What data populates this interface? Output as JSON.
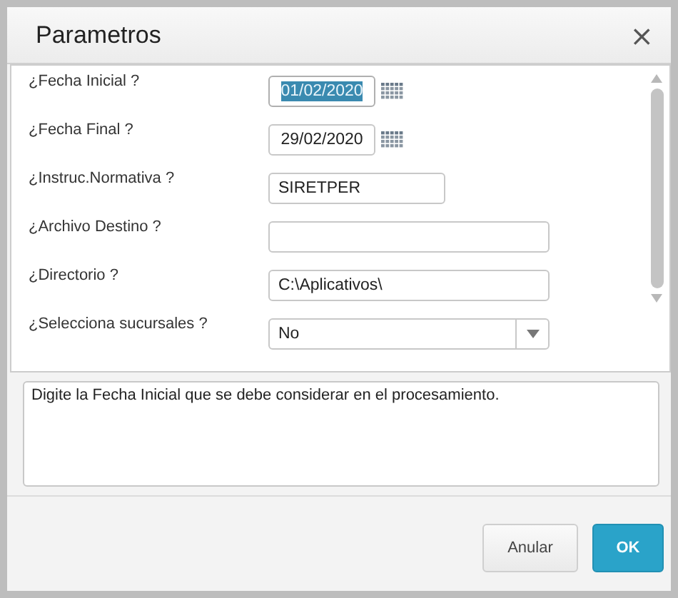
{
  "window": {
    "title": "Parametros",
    "close": "×"
  },
  "fields": [
    {
      "label": "¿Fecha Inicial ?",
      "kind": "date",
      "value": "01/02/2020",
      "selected": true
    },
    {
      "label": "¿Fecha Final ?",
      "kind": "date",
      "value": "29/02/2020",
      "selected": false
    },
    {
      "label": "¿Instruc.Normativa ?",
      "kind": "short",
      "value": "SIRETPER"
    },
    {
      "label": "¿Archivo Destino ?",
      "kind": "text"
    },
    {
      "label": "¿Directorio ?",
      "kind": "text",
      "value": "C:\\Aplicativos\\"
    },
    {
      "label": "¿Selecciona sucursales ?",
      "kind": "select",
      "value": "No"
    }
  ],
  "help": "Digite la Fecha Inicial que se debe considerar en el procesamiento.",
  "buttons": [
    {
      "label": "Anular",
      "kind": "secondary"
    },
    {
      "label": "OK",
      "kind": "primary"
    }
  ]
}
